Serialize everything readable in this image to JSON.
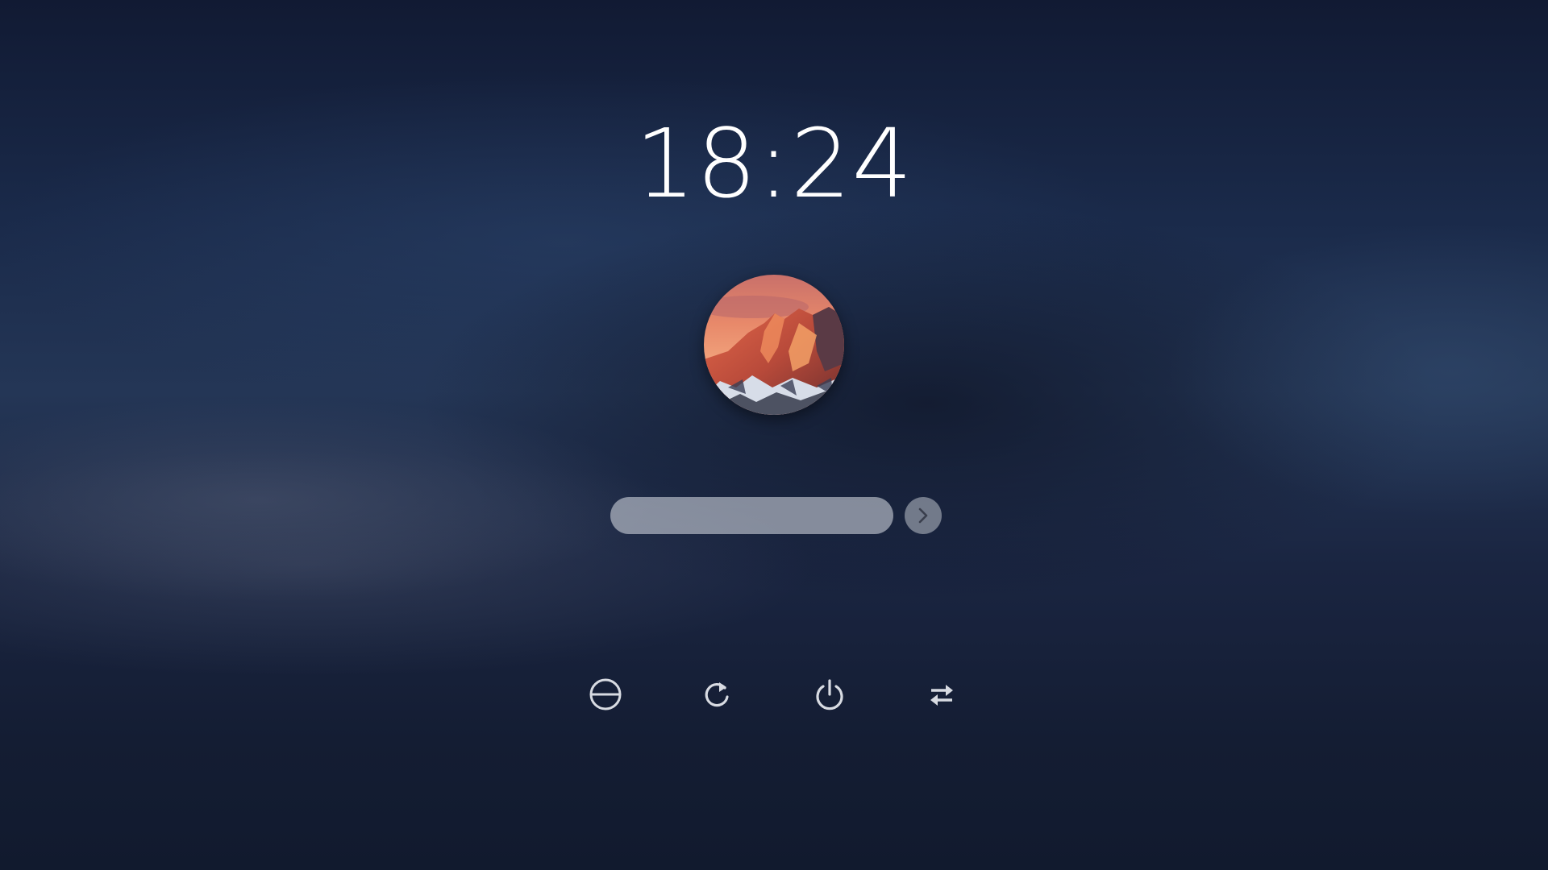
{
  "lock_screen": {
    "time": "18:24",
    "user": {
      "avatar_icon": "mountain-avatar"
    },
    "password": {
      "value": "",
      "placeholder": ""
    },
    "submit_icon": "chevron-right-icon",
    "power_actions": [
      {
        "icon": "suspend-icon"
      },
      {
        "icon": "restart-icon"
      },
      {
        "icon": "shutdown-icon"
      },
      {
        "icon": "switch-user-icon"
      }
    ]
  },
  "colors": {
    "text": "#ffffff",
    "field_bg": "#c8cdd7",
    "icon": "#d8dbe2"
  }
}
